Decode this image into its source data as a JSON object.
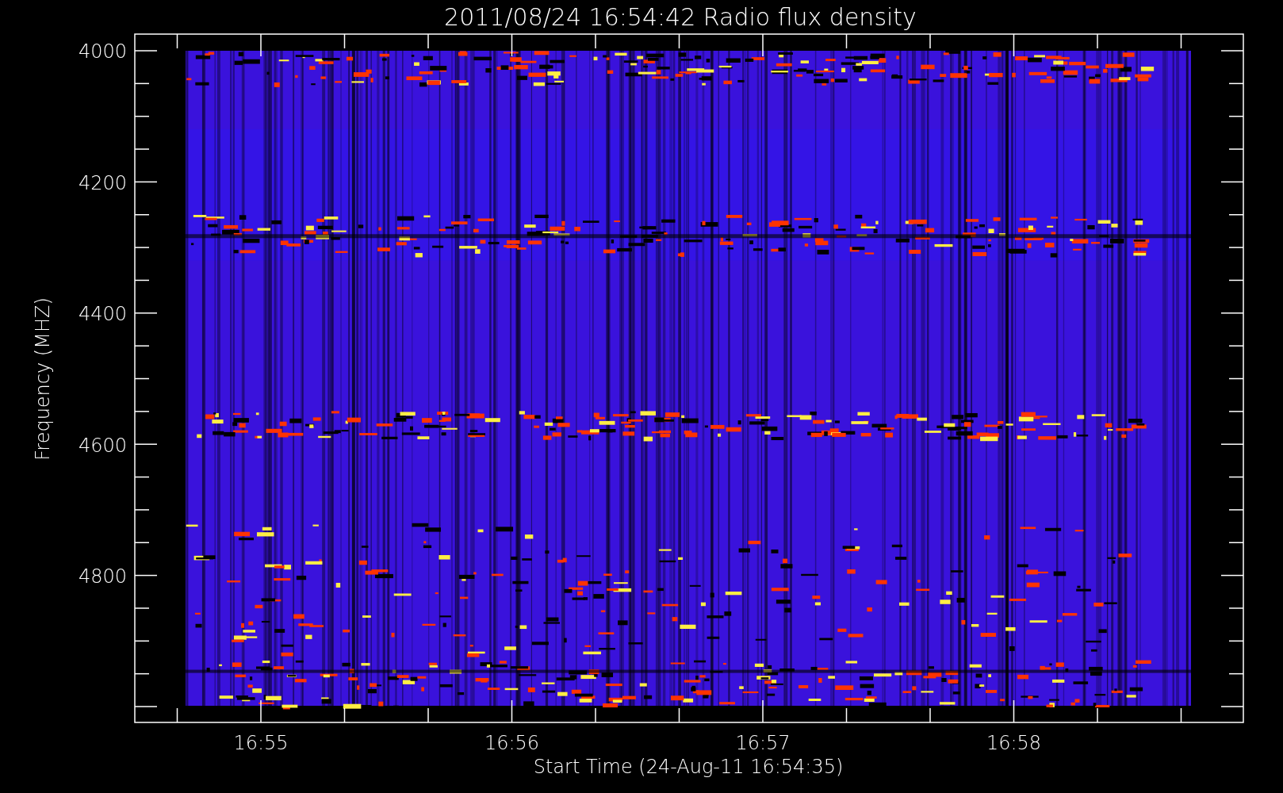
{
  "title": "2011/08/24 16:54:42 Radio flux density",
  "y_axis": {
    "label": "Frequency (MHZ)",
    "ticks": [
      "4000",
      "4200",
      "4400",
      "4600",
      "4800"
    ]
  },
  "x_axis": {
    "label": "Start Time (24-Aug-11 16:54:35)",
    "ticks": [
      "16:55",
      "16:56",
      "16:57",
      "16:58"
    ]
  }
}
